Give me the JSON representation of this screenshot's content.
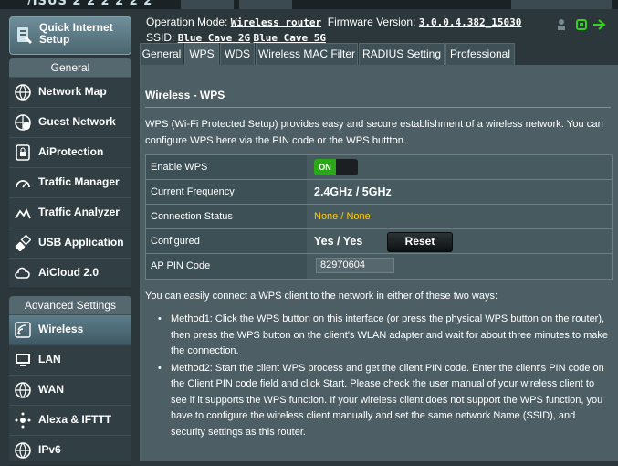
{
  "top": {
    "logo": "/ISUS  2 2 2 2 2 2"
  },
  "sidebar": {
    "quick_setup": "Quick Internet Setup",
    "general_title": "General",
    "general_items": [
      {
        "label": "Network Map",
        "icon": "network-map-icon"
      },
      {
        "label": "Guest Network",
        "icon": "guest-network-icon"
      },
      {
        "label": "AiProtection",
        "icon": "lock-icon"
      },
      {
        "label": "Traffic Manager",
        "icon": "gauge-icon"
      },
      {
        "label": "Traffic Analyzer",
        "icon": "analyzer-icon"
      },
      {
        "label": "USB Application",
        "icon": "usb-icon"
      },
      {
        "label": "AiCloud 2.0",
        "icon": "cloud-icon"
      }
    ],
    "advanced_title": "Advanced Settings",
    "advanced_items": [
      {
        "label": "Wireless",
        "icon": "wifi-icon",
        "active": true
      },
      {
        "label": "LAN",
        "icon": "lan-icon"
      },
      {
        "label": "WAN",
        "icon": "globe-icon"
      },
      {
        "label": "Alexa & IFTTT",
        "icon": "alexa-icon"
      },
      {
        "label": "IPv6",
        "icon": "ipv6-icon"
      }
    ]
  },
  "header": {
    "mode_label": "Operation Mode:",
    "mode_value": "Wireless router",
    "fw_label": "Firmware Version:",
    "fw_value": "3.0.0.4.382_15030",
    "ssid_label": "SSID:",
    "ssid_2g": "Blue_Cave_2G",
    "ssid_5g": "Blue_Cave_5G"
  },
  "tabs": [
    "General",
    "WPS",
    "WDS",
    "Wireless MAC Filter",
    "RADIUS Setting",
    "Professional"
  ],
  "selected_tab": "WPS",
  "panel": {
    "title": "Wireless - WPS",
    "description": "WPS (Wi-Fi Protected Setup) provides easy and secure establishment of a wireless network. You can configure WPS here via the PIN code or the WPS buttton.",
    "rows": {
      "enable_label": "Enable WPS",
      "enable_state": "ON",
      "freq_label": "Current Frequency",
      "freq_value": "2.4GHz / 5GHz",
      "conn_label": "Connection Status",
      "conn_value": "None / None",
      "conf_label": "Configured",
      "conf_value": "Yes / Yes",
      "reset_label": "Reset",
      "pin_label": "AP PIN Code",
      "pin_value": "82970604"
    },
    "hint": "You can easily connect a WPS client to the network in either of these two ways:",
    "method1": "Method1: Click the WPS button on this interface (or press the physical WPS button on the router), then press the WPS button on the client's WLAN adapter and wait for about three minutes to make the connection.",
    "method2": "Method2: Start the client WPS process and get the client PIN code. Enter the client's PIN code on the Client PIN code field and click Start. Please check the user manual of your wireless client to see if it supports the WPS function. If your wireless client does not support the WPS function, you have to configure the wireless client manually and set the same network Name (SSID), and security settings as this router."
  }
}
